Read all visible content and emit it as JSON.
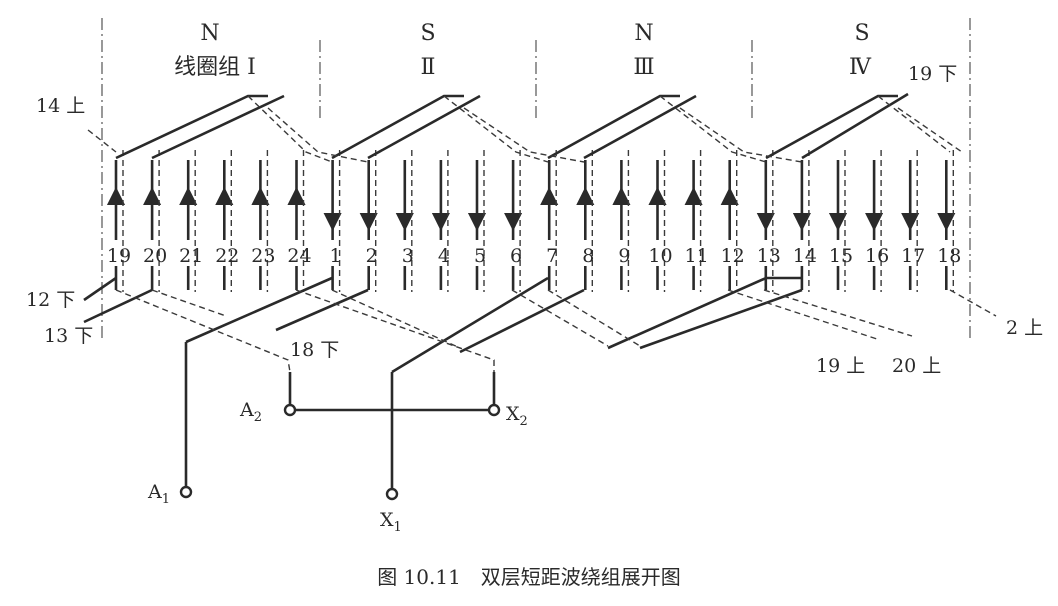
{
  "poles": [
    {
      "pole": "N",
      "coil_group": "线圈组 Ⅰ"
    },
    {
      "pole": "S",
      "coil_group": "Ⅱ"
    },
    {
      "pole": "N",
      "coil_group": "Ⅲ"
    },
    {
      "pole": "S",
      "coil_group": "Ⅳ"
    }
  ],
  "slots": [
    "19",
    "20",
    "21",
    "22",
    "23",
    "24",
    "1",
    "2",
    "3",
    "4",
    "5",
    "6",
    "7",
    "8",
    "9",
    "10",
    "11",
    "12",
    "13",
    "14",
    "15",
    "16",
    "17",
    "18"
  ],
  "current_direction": [
    "up",
    "up",
    "up",
    "up",
    "up",
    "up",
    "down",
    "down",
    "down",
    "down",
    "down",
    "down",
    "up",
    "up",
    "up",
    "up",
    "up",
    "up",
    "down",
    "down",
    "down",
    "down",
    "down",
    "down"
  ],
  "connection_labels": {
    "left_top": "14 上",
    "left_mid": "12 下",
    "left_bottom": "13 下",
    "right_top": "19 下",
    "right_bottom": "2 上",
    "mid_18": "18 下",
    "bottom_19": "19 上",
    "bottom_20": "20 上"
  },
  "terminals": {
    "A1": {
      "letter": "A",
      "sub": "1"
    },
    "A2": {
      "letter": "A",
      "sub": "2"
    },
    "X1": {
      "letter": "X",
      "sub": "1"
    },
    "X2": {
      "letter": "X",
      "sub": "2"
    }
  },
  "caption": "图 10.11　双层短距波绕组展开图"
}
